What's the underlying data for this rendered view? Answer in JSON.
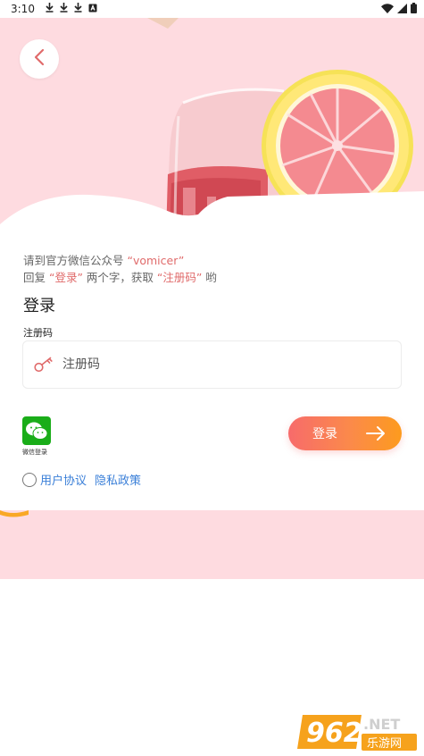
{
  "status_bar": {
    "time": "3:10",
    "notification_icons": [
      "download-icon",
      "download-icon",
      "download-icon",
      "app-icon"
    ],
    "right_icons": [
      "wifi-icon",
      "signal-icon",
      "battery-icon"
    ]
  },
  "hint": {
    "line1_prefix": "请到官方微信公众号 ",
    "line1_account": "“vomicer”",
    "line2_prefix": "回复 ",
    "line2_keyword": "“登录”",
    "line2_middle": " 两个字，获取 ",
    "line2_code": "“注册码”",
    "line2_suffix": " 哟"
  },
  "login": {
    "title": "登录",
    "code_label": "注册码",
    "code_placeholder": "注册码",
    "code_value": "",
    "wechat_label": "微信登录",
    "login_button": "登录"
  },
  "agreement": {
    "checked": false,
    "user_agreement": "用户协议",
    "privacy_policy": "隐私政策"
  },
  "watermark": {
    "number": "962",
    "domain": ".NET",
    "site": "乐游网"
  },
  "colors": {
    "hero_bg": "#fedbe0",
    "accent_red": "#e06b6b",
    "button_start": "#f76b6b",
    "button_end": "#fd9b1e",
    "link_blue": "#3a7fd8",
    "wechat_green": "#1aad19"
  }
}
